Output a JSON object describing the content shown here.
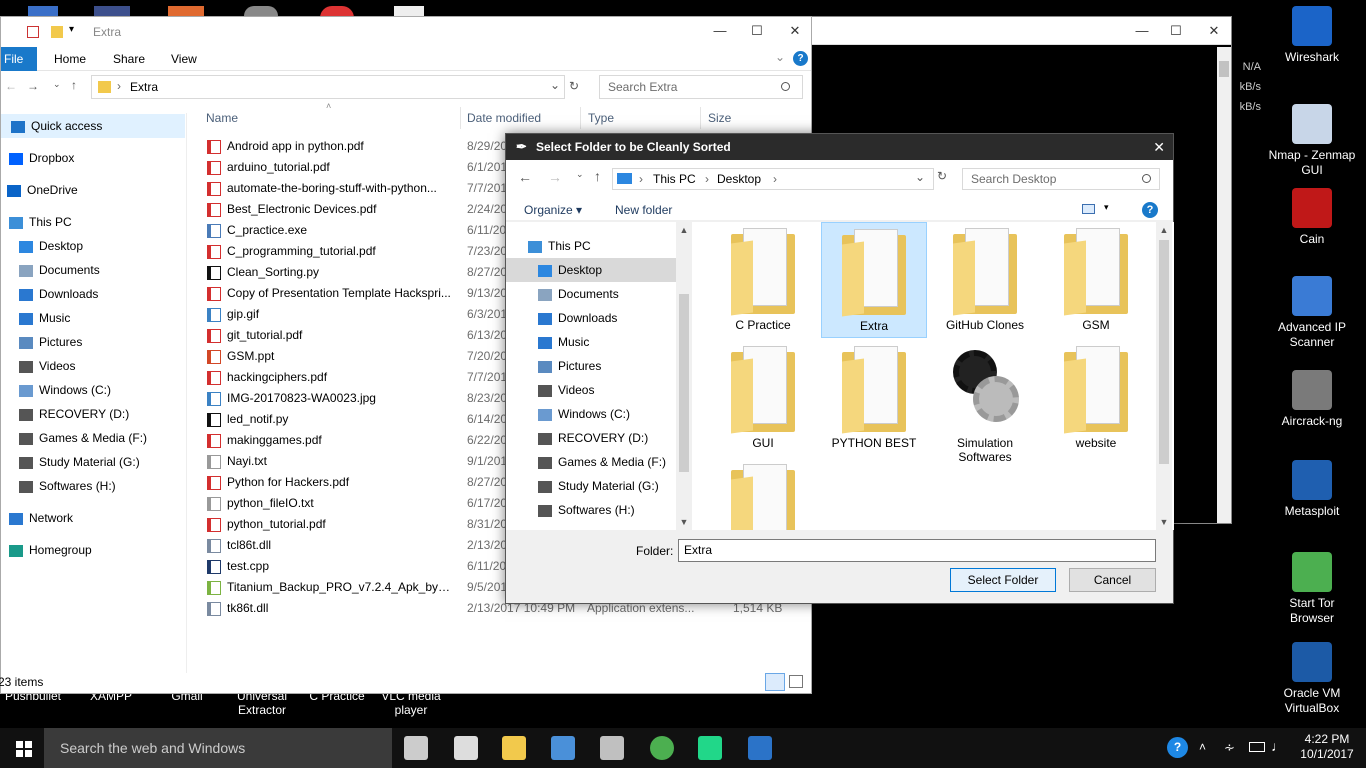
{
  "desktop_bottom_labels": [
    {
      "text": "Pushbullet"
    },
    {
      "text": "XAMPP"
    },
    {
      "text": "Gmail"
    },
    {
      "text": "Universal\nExtractor"
    },
    {
      "text": "C Practice"
    },
    {
      "text": "VLC media\nplayer"
    }
  ],
  "desktop_right_icons": [
    {
      "label": "Wireshark",
      "color": "#1b64c8"
    },
    {
      "label": "Nmap - Zenmap GUI",
      "color": "#c8d6e8"
    },
    {
      "label": "Cain",
      "color": "#c01818"
    },
    {
      "label": "Advanced IP Scanner",
      "color": "#3a7bd5"
    },
    {
      "label": "Aircrack-ng",
      "color": "#7a7a7a"
    },
    {
      "label": "Metasploit",
      "color": "#1f5fb0"
    },
    {
      "label": "Start Tor Browser",
      "color": "#4caf50"
    },
    {
      "label": "Oracle VM VirtualBox",
      "color": "#1c5aa6"
    }
  ],
  "bg_window": {
    "readouts": [
      "N/A",
      "kB/s",
      "kB/s"
    ]
  },
  "explorer": {
    "title": "Extra",
    "ribbon": {
      "file": "File",
      "home": "Home",
      "share": "Share",
      "view": "View"
    },
    "address": {
      "path": "Extra"
    },
    "search_placeholder": "Search Extra",
    "nav": [
      {
        "label": "Quick access",
        "icon": "star-icon",
        "color": "#1e73c8"
      },
      {
        "label": "Dropbox",
        "icon": "dropbox-icon",
        "color": "#0061fe"
      },
      {
        "label": "OneDrive",
        "icon": "cloud-icon",
        "color": "#0a64c8"
      },
      {
        "label": "This PC",
        "icon": "computer-icon",
        "color": "#3c8fd8"
      },
      {
        "label": "Desktop",
        "icon": "desktop-icon",
        "color": "#2c87e0"
      },
      {
        "label": "Documents",
        "icon": "documents-icon",
        "color": "#8aa4c0"
      },
      {
        "label": "Downloads",
        "icon": "downloads-icon",
        "color": "#2a78d0"
      },
      {
        "label": "Music",
        "icon": "music-icon",
        "color": "#2a78d0"
      },
      {
        "label": "Pictures",
        "icon": "pictures-icon",
        "color": "#5a8ac0"
      },
      {
        "label": "Videos",
        "icon": "videos-icon",
        "color": "#555"
      },
      {
        "label": "Windows (C:)",
        "icon": "drive-icon",
        "color": "#6a9ad0"
      },
      {
        "label": "RECOVERY (D:)",
        "icon": "drive-icon",
        "color": "#555"
      },
      {
        "label": "Games & Media (F:)",
        "icon": "drive-icon",
        "color": "#555"
      },
      {
        "label": "Study Material (G:)",
        "icon": "drive-icon",
        "color": "#555"
      },
      {
        "label": "Softwares (H:)",
        "icon": "drive-icon",
        "color": "#555"
      },
      {
        "label": "Network",
        "icon": "network-icon",
        "color": "#2a78d0"
      },
      {
        "label": "Homegroup",
        "icon": "homegroup-icon",
        "color": "#1a9a8a"
      }
    ],
    "columns": {
      "name": "Name",
      "date": "Date modified",
      "type": "Type",
      "size": "Size"
    },
    "files": [
      {
        "name": "Android app in python.pdf",
        "date": "8/29/2017",
        "icon": "pdf-icon"
      },
      {
        "name": "arduino_tutorial.pdf",
        "date": "6/1/2017",
        "icon": "pdf-icon"
      },
      {
        "name": "automate-the-boring-stuff-with-python...",
        "date": "7/7/2017",
        "icon": "pdf-icon"
      },
      {
        "name": "Best_Electronic Devices.pdf",
        "date": "2/24/2017",
        "icon": "pdf-icon"
      },
      {
        "name": "C_practice.exe",
        "date": "6/11/2017",
        "icon": "exe-icon"
      },
      {
        "name": "C_programming_tutorial.pdf",
        "date": "7/23/2017",
        "icon": "pdf-icon"
      },
      {
        "name": "Clean_Sorting.py",
        "date": "8/27/2017",
        "icon": "python-icon"
      },
      {
        "name": "Copy of Presentation Template Hackspri...",
        "date": "9/13/2017",
        "icon": "pdf-icon"
      },
      {
        "name": "gip.gif",
        "date": "6/3/2017",
        "icon": "image-icon"
      },
      {
        "name": "git_tutorial.pdf",
        "date": "6/13/2017",
        "icon": "pdf-icon"
      },
      {
        "name": "GSM.ppt",
        "date": "7/20/2017",
        "icon": "ppt-icon"
      },
      {
        "name": "hackingciphers.pdf",
        "date": "7/7/2017",
        "icon": "pdf-icon"
      },
      {
        "name": "IMG-20170823-WA0023.jpg",
        "date": "8/23/2017",
        "icon": "image-icon"
      },
      {
        "name": "led_notif.py",
        "date": "6/14/2017",
        "icon": "python-icon"
      },
      {
        "name": "makinggames.pdf",
        "date": "6/22/2017",
        "icon": "pdf-icon"
      },
      {
        "name": "Nayi.txt",
        "date": "9/1/2017",
        "icon": "text-icon"
      },
      {
        "name": "Python for Hackers.pdf",
        "date": "8/27/2017",
        "icon": "pdf-icon"
      },
      {
        "name": "python_fileIO.txt",
        "date": "6/17/2017",
        "icon": "text-icon"
      },
      {
        "name": "python_tutorial.pdf",
        "date": "8/31/2017",
        "icon": "pdf-icon"
      },
      {
        "name": "tcl86t.dll",
        "date": "2/13/2017",
        "icon": "dll-icon"
      },
      {
        "name": "test.cpp",
        "date": "6/11/2017",
        "icon": "cpp-icon"
      },
      {
        "name": "Titanium_Backup_PRO_v7.2.4_Apk_by_O...",
        "date": "9/5/2017",
        "icon": "archive-icon"
      },
      {
        "name": "tk86t.dll",
        "date": "2/13/2017 10:49 PM",
        "icon": "dll-icon"
      }
    ],
    "last_row_type": "Application extens...",
    "last_row_size": "1,514 KB",
    "status": "23 items"
  },
  "dialog": {
    "title": "Select Folder to be Cleanly Sorted",
    "breadcrumb": {
      "root": "This PC",
      "current": "Desktop"
    },
    "search_placeholder": "Search Desktop",
    "organize": "Organize ▾",
    "new_folder": "New folder",
    "nav": [
      {
        "label": "This PC",
        "icon": "computer-icon",
        "color": "#3c8fd8"
      },
      {
        "label": "Desktop",
        "icon": "desktop-icon",
        "color": "#2c87e0"
      },
      {
        "label": "Documents",
        "icon": "documents-icon",
        "color": "#8aa4c0"
      },
      {
        "label": "Downloads",
        "icon": "downloads-icon",
        "color": "#2a78d0"
      },
      {
        "label": "Music",
        "icon": "music-icon",
        "color": "#2a78d0"
      },
      {
        "label": "Pictures",
        "icon": "pictures-icon",
        "color": "#5a8ac0"
      },
      {
        "label": "Videos",
        "icon": "videos-icon",
        "color": "#555"
      },
      {
        "label": "Windows (C:)",
        "icon": "drive-icon",
        "color": "#6a9ad0"
      },
      {
        "label": "RECOVERY (D:)",
        "icon": "drive-icon",
        "color": "#555"
      },
      {
        "label": "Games & Media (F:)",
        "icon": "drive-icon",
        "color": "#555"
      },
      {
        "label": "Study Material (G:)",
        "icon": "drive-icon",
        "color": "#555"
      },
      {
        "label": "Softwares (H:)",
        "icon": "drive-icon",
        "color": "#555"
      }
    ],
    "folders": [
      {
        "label": "C Practice",
        "selected": false
      },
      {
        "label": "Extra",
        "selected": true
      },
      {
        "label": "GitHub Clones",
        "selected": false
      },
      {
        "label": "GSM",
        "selected": false
      },
      {
        "label": "GUI",
        "selected": false
      },
      {
        "label": "PYTHON BEST",
        "selected": false
      },
      {
        "label": "Simulation Softwares",
        "selected": false
      },
      {
        "label": "website",
        "selected": false
      },
      {
        "label": "",
        "selected": false
      }
    ],
    "folder_label": "Folder:",
    "folder_value": "Extra",
    "select_button": "Select Folder",
    "cancel_button": "Cancel"
  },
  "taskbar": {
    "search_placeholder": "Search the web and Windows",
    "time": "4:22 PM",
    "date": "10/1/2017",
    "apps": [
      {
        "name": "task-view-icon",
        "color": "#ccc"
      },
      {
        "name": "camera-icon",
        "color": "#ddd"
      },
      {
        "name": "file-explorer-icon",
        "color": "#f2c94c"
      },
      {
        "name": "store-icon",
        "color": "#4a90d9"
      },
      {
        "name": "wireshark-taskbar-icon",
        "color": "#c0c0c0"
      },
      {
        "name": "chrome-icon",
        "color": "#4caf50"
      },
      {
        "name": "pycharm-icon",
        "color": "#21d789"
      },
      {
        "name": "app-icon",
        "color": "#2b73c8"
      }
    ]
  }
}
